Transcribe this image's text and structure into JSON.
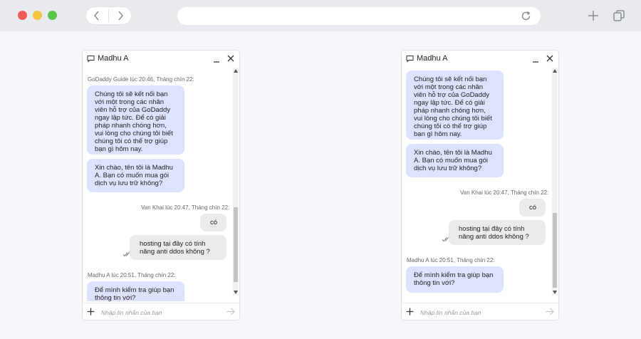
{
  "chat_windows": [
    {
      "title": "Madhu A",
      "placeholder": "Nhập tin nhắn của bạn",
      "meta_agent": "GoDaddy Guide lúc 20:46, Tháng chín 22:",
      "msg1": "Chúng tôi sẽ kết nối bạn\nvới một trong các nhân\nviên hỗ trợ của GoDaddy\nngay lập tức. Để có giải\npháp nhanh chóng hơn,\nvui lòng cho chúng tôi biết\nchúng tôi có thể trợ giúp\nbạn gì hôm nay.",
      "msg2": "Xin chào, tên tôi là Madhu\nA. Bạn có muốn mua gói\ndịch vụ lưu trữ không?",
      "meta_user": "Van Khai lúc 20:47, Tháng chín 22:",
      "user1": "có",
      "user2": "hosting tại đây có tính\nnăng anti ddos không ?",
      "meta_agent2": "Madhu A lúc 20:51, Tháng chín 22:",
      "msg3": "Để mình kiểm tra giúp bạn\nthông tin với?"
    },
    {
      "title": "Madhu A",
      "placeholder": "Nhập tin nhắn của bạn",
      "msg1": "Chúng tôi sẽ kết nối bạn\nvới một trong các nhân\nviên hỗ trợ của GoDaddy\nngay lập tức. Để có giải\npháp nhanh chóng hơn,\nvui lòng cho chúng tôi biết\nchúng tôi có thể trợ giúp\nbạn gì hôm nay.",
      "msg2": "Xin chào, tên tôi là Madhu\nA. Bạn có muốn mua gói\ndịch vụ lưu trữ không?",
      "meta_user": "Van Khai lúc 20:47, Tháng chín 22:",
      "user1": "có",
      "user2": "hosting tại đây có tính\nnăng anti ddos không ?",
      "meta_agent2": "Madhu A lúc 20:51, Tháng chín 22:",
      "msg3": "Để mình kiểm tra giúp bạn\nthông tin với?"
    }
  ],
  "icons": {
    "chat": "chat-bubble-icon",
    "minimize": "minimize-icon",
    "close": "close-icon",
    "add": "plus-icon",
    "send": "send-arrow-icon",
    "read": "double-check-icon",
    "reload": "reload-icon",
    "new_tab": "plus-icon",
    "tabs": "tabs-icon",
    "back": "chevron-left-icon",
    "forward": "chevron-right-icon"
  },
  "colors": {
    "agent_bubble": "#dde3ff",
    "user_bubble": "#ebebeb",
    "chrome": "#e8eaf0"
  }
}
